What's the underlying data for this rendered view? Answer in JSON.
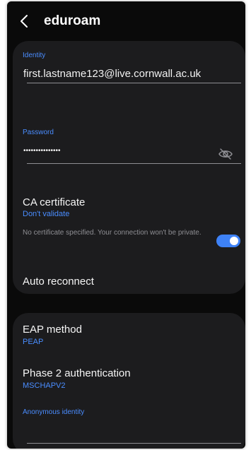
{
  "header": {
    "title": "eduroam"
  },
  "identity": {
    "label": "Identity",
    "value": "first.lastname123@live.cornwall.ac.uk"
  },
  "password": {
    "label": "Password",
    "masked_value": "•••••••••••••••"
  },
  "ca_certificate": {
    "title": "CA certificate",
    "value": "Don't validate",
    "note": "No certificate specified. Your connection won't be private."
  },
  "auto_reconnect": {
    "label": "Auto reconnect",
    "enabled": true
  },
  "eap_method": {
    "title": "EAP method",
    "value": "PEAP"
  },
  "phase2": {
    "title": "Phase 2 authentication",
    "value": "MSCHAPV2"
  },
  "anonymous_identity": {
    "label": "Anonymous identity",
    "value": ""
  },
  "colors": {
    "accent": "#4a8dff",
    "toggle_on": "#3e82f7",
    "background": "#0a0a0a",
    "card": "#1c1c1e"
  }
}
